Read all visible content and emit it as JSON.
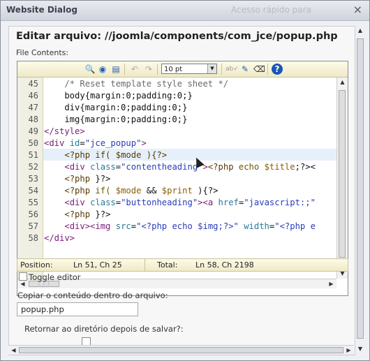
{
  "window": {
    "title": "Website Dialog",
    "watermark": "Acesso rápido para",
    "close": "×"
  },
  "heading": "Editar arquivo: //joomla/components/com_jce/popup.php",
  "file_contents_label": "File Contents:",
  "toolbar": {
    "icons": [
      "find-icon",
      "replace-icon",
      "gotoline-icon",
      "undo-icon",
      "redo-icon",
      "spellcheck-icon",
      "format-icon",
      "clear-icon",
      "help-icon"
    ],
    "font_size": "10 pt"
  },
  "code": {
    "lines": [
      {
        "n": "45",
        "html": "<span class='c-cm'>    /* Reset template style sheet */</span>"
      },
      {
        "n": "46",
        "html": "    body{margin:0;padding:0;}"
      },
      {
        "n": "47",
        "html": "    div{margin:0;padding:0;}"
      },
      {
        "n": "48",
        "html": "    img{margin:0;padding:0;}"
      },
      {
        "n": "49",
        "html": "<span class='c-tag'>&lt;/style&gt;</span>"
      },
      {
        "n": "50",
        "html": "<span class='c-tag'>&lt;div</span> <span class='c-attr'>id</span>=<span class='c-str'>\"jce_popup\"</span><span class='c-tag'>&gt;</span>"
      },
      {
        "n": "51",
        "html": "    <span class='c-php'>&lt;?php if( $mode ){?&gt;</span>"
      },
      {
        "n": "52",
        "html": "    <span class='c-tag'>&lt;div</span> <span class='c-attr'>class</span>=<span class='c-str'>\"contentheading\"</span><span class='c-tag'>&gt;</span><span class='c-php'>&lt;?php</span> <span class='c-kw'>echo</span> <span class='c-var'>$title</span>;?&gt;&lt;"
      },
      {
        "n": "53",
        "html": "    <span class='c-php'>&lt;?php</span> }?&gt;"
      },
      {
        "n": "54",
        "html": "    <span class='c-php'>&lt;?php</span> <span class='c-kw'>if(</span> <span class='c-var'>$mode</span> &amp;&amp; <span class='c-var'>$print</span> ){?&gt;"
      },
      {
        "n": "55",
        "html": "    <span class='c-tag'>&lt;div</span> <span class='c-attr'>class</span>=<span class='c-str'>\"buttonheading\"</span><span class='c-tag'>&gt;&lt;a</span> <span class='c-attr'>href</span>=<span class='c-str'>\"javascript:;\"</span>"
      },
      {
        "n": "56",
        "html": "    <span class='c-php'>&lt;?php</span> }?&gt;"
      },
      {
        "n": "57",
        "html": "    <span class='c-tag'>&lt;div&gt;&lt;img</span> <span class='c-attr'>src</span>=<span class='c-str'>\"&lt;?php echo $img;?&gt;\"</span> <span class='c-attr'>width</span>=<span class='c-str'>\"&lt;?php e</span>"
      },
      {
        "n": "58",
        "html": "<span class='c-tag'>&lt;/div&gt;</span>"
      }
    ]
  },
  "status": {
    "position_label": "Position:",
    "position_value": "Ln 51, Ch 25",
    "total_label": "Total:",
    "total_value": "Ln 58, Ch 2198"
  },
  "toggle_label": "Toggle editor",
  "copy_label": "Copiar o conteúdo dentro do arquivo:",
  "filename_value": "popup.php",
  "return_label": "Retornar ao diretório depois de salvar?:"
}
